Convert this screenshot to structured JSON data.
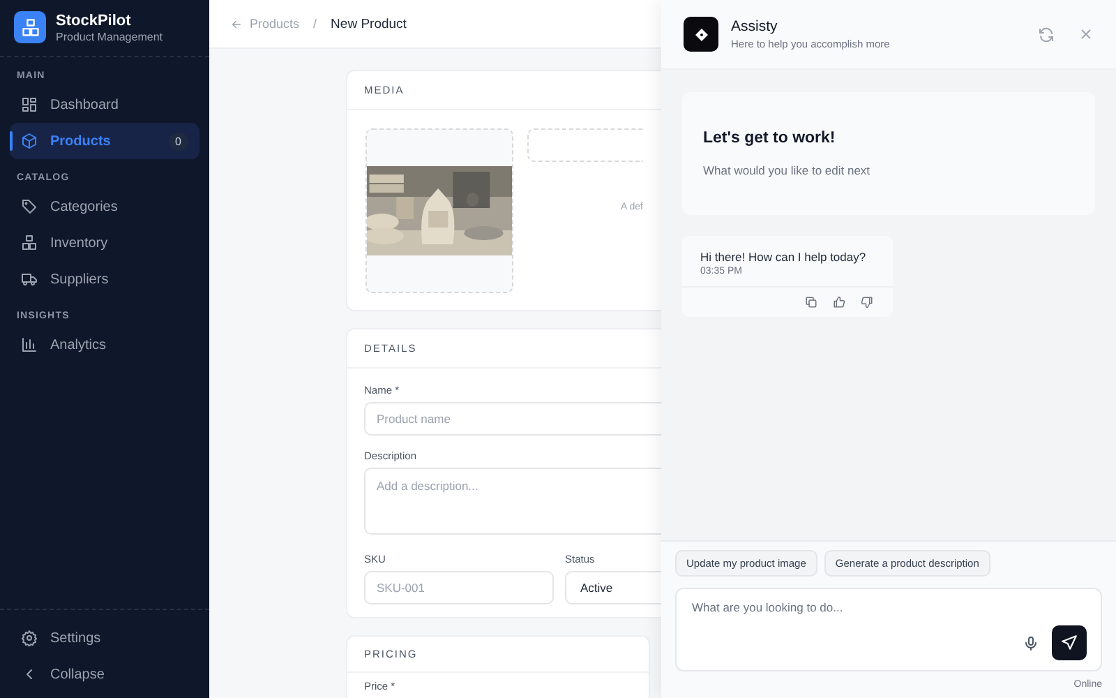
{
  "sidebar": {
    "brand": {
      "name": "StockPilot",
      "subtitle": "Product Management"
    },
    "sections": [
      {
        "label": "MAIN",
        "items": [
          {
            "label": "Dashboard",
            "selected": false
          },
          {
            "label": "Products",
            "selected": true,
            "badge": "0"
          }
        ]
      },
      {
        "label": "CATALOG",
        "items": [
          {
            "label": "Categories",
            "selected": false
          },
          {
            "label": "Inventory",
            "selected": false
          },
          {
            "label": "Suppliers",
            "selected": false
          }
        ]
      },
      {
        "label": "INSIGHTS",
        "items": [
          {
            "label": "Analytics",
            "selected": false
          }
        ]
      }
    ],
    "footer_items": [
      {
        "label": "Settings"
      },
      {
        "label": "Collapse"
      }
    ]
  },
  "breadcrumb": {
    "back": "Products",
    "separator": "/",
    "current": "New Product"
  },
  "media": {
    "title": "MEDIA",
    "note": "A def"
  },
  "details": {
    "title": "DETAILS",
    "name": {
      "label": "Name *",
      "placeholder": "Product name"
    },
    "description": {
      "label": "Description",
      "placeholder": "Add a description..."
    },
    "sku": {
      "label": "SKU",
      "placeholder": "SKU-001"
    },
    "status": {
      "label": "Status",
      "value": "Active"
    }
  },
  "pricing": {
    "title": "PRICING",
    "price_label": "Price *"
  },
  "assistant": {
    "title": "Assisty",
    "subtitle": "Here to help you accomplish more",
    "welcome": {
      "title": "Let's get to work!",
      "text": "What would you like to edit next"
    },
    "messages": [
      {
        "text": "Hi there! How can I help today?",
        "time": "03:35 PM"
      }
    ],
    "suggestions": [
      "Update my product image",
      "Generate a product description"
    ],
    "input": {
      "placeholder": "What are you looking to do..."
    },
    "status": "Online"
  }
}
